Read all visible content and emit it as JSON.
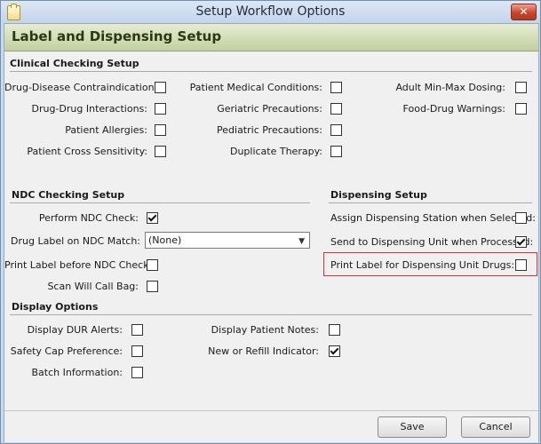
{
  "window": {
    "title": "Setup Workflow Options",
    "close_glyph": "✕",
    "icon": "document-icon"
  },
  "header": {
    "title": "Label and Dispensing Setup"
  },
  "clinical": {
    "title": "Clinical Checking Setup",
    "items": [
      {
        "label": "Drug-Disease Contraindications:",
        "checked": false
      },
      {
        "label": "Drug-Drug Interactions:",
        "checked": false
      },
      {
        "label": "Patient Allergies:",
        "checked": false
      },
      {
        "label": "Patient Cross Sensitivity:",
        "checked": false
      },
      {
        "label": "Patient Medical Conditions:",
        "checked": false
      },
      {
        "label": "Geriatric Precautions:",
        "checked": false
      },
      {
        "label": "Pediatric Precautions:",
        "checked": false
      },
      {
        "label": "Duplicate Therapy:",
        "checked": false
      },
      {
        "label": "Adult Min-Max Dosing:",
        "checked": false
      },
      {
        "label": "Food-Drug Warnings:",
        "checked": false
      }
    ]
  },
  "ndc": {
    "title": "NDC Checking Setup",
    "perform_label": "Perform NDC Check:",
    "perform_checked": true,
    "drug_label": "Drug Label on NDC Match:",
    "drug_label_value": "(None)",
    "print_label": "Print Label before NDC Check:",
    "print_checked": false,
    "scan_label": "Scan Will Call Bag:",
    "scan_checked": false
  },
  "dispensing": {
    "title": "Dispensing Setup",
    "assign_label": "Assign Dispensing Station when Selected:",
    "assign_checked": false,
    "send_label": "Send to Dispensing Unit when Processed:",
    "send_checked": true,
    "print_label": "Print Label for Dispensing Unit Drugs:",
    "print_checked": false
  },
  "display": {
    "title": "Display Options",
    "dur_label": "Display DUR Alerts:",
    "dur_checked": false,
    "safety_label": "Safety Cap Preference:",
    "safety_checked": false,
    "batch_label": "Batch Information:",
    "batch_checked": false,
    "notes_label": "Display Patient Notes:",
    "notes_checked": false,
    "refill_label": "New or Refill Indicator:",
    "refill_checked": true
  },
  "footer": {
    "save": "Save",
    "cancel": "Cancel"
  }
}
